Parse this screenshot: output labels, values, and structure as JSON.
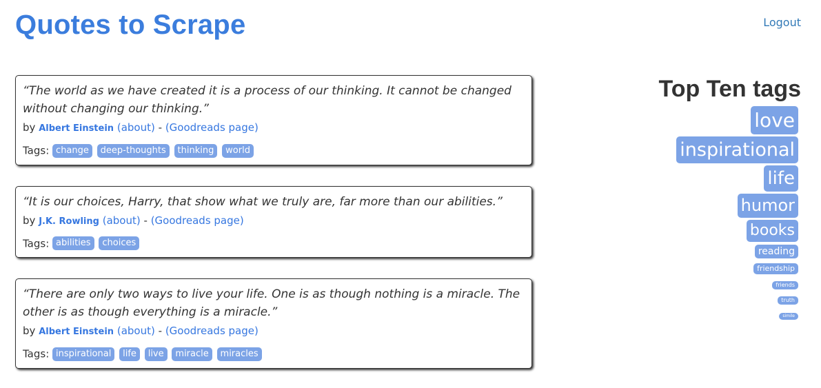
{
  "header": {
    "site_title": "Quotes to Scrape",
    "logout_label": "Logout"
  },
  "colors": {
    "accent": "#3b7ddd",
    "link": "#3677e0",
    "tag_bg": "#7ca3e6"
  },
  "quotes": [
    {
      "text": "“The world as we have created it is a process of our thinking. It cannot be changed without changing our thinking.”",
      "by": "by",
      "author": "Albert Einstein",
      "about": "(about)",
      "separator": "-",
      "goodreads": "(Goodreads page)",
      "tags_label": "Tags:",
      "tags": [
        "change",
        "deep-thoughts",
        "thinking",
        "world"
      ]
    },
    {
      "text": "“It is our choices, Harry, that show what we truly are, far more than our abilities.”",
      "by": "by",
      "author": "J.K. Rowling",
      "about": "(about)",
      "separator": "-",
      "goodreads": "(Goodreads page)",
      "tags_label": "Tags:",
      "tags": [
        "abilities",
        "choices"
      ]
    },
    {
      "text": "“There are only two ways to live your life. One is as though nothing is a miracle. The other is as though everything is a miracle.”",
      "by": "by",
      "author": "Albert Einstein",
      "about": "(about)",
      "separator": "-",
      "goodreads": "(Goodreads page)",
      "tags_label": "Tags:",
      "tags": [
        "inspirational",
        "life",
        "live",
        "miracle",
        "miracles"
      ]
    }
  ],
  "sidebar": {
    "heading": "Top Ten tags",
    "tags": [
      {
        "label": "love",
        "weight": 28
      },
      {
        "label": "inspirational",
        "weight": 27
      },
      {
        "label": "life",
        "weight": 26
      },
      {
        "label": "humor",
        "weight": 24
      },
      {
        "label": "books",
        "weight": 22
      },
      {
        "label": "reading",
        "weight": 14
      },
      {
        "label": "friendship",
        "weight": 11
      },
      {
        "label": "friends",
        "weight": 8
      },
      {
        "label": "truth",
        "weight": 8
      },
      {
        "label": "simile",
        "weight": 6
      }
    ]
  }
}
